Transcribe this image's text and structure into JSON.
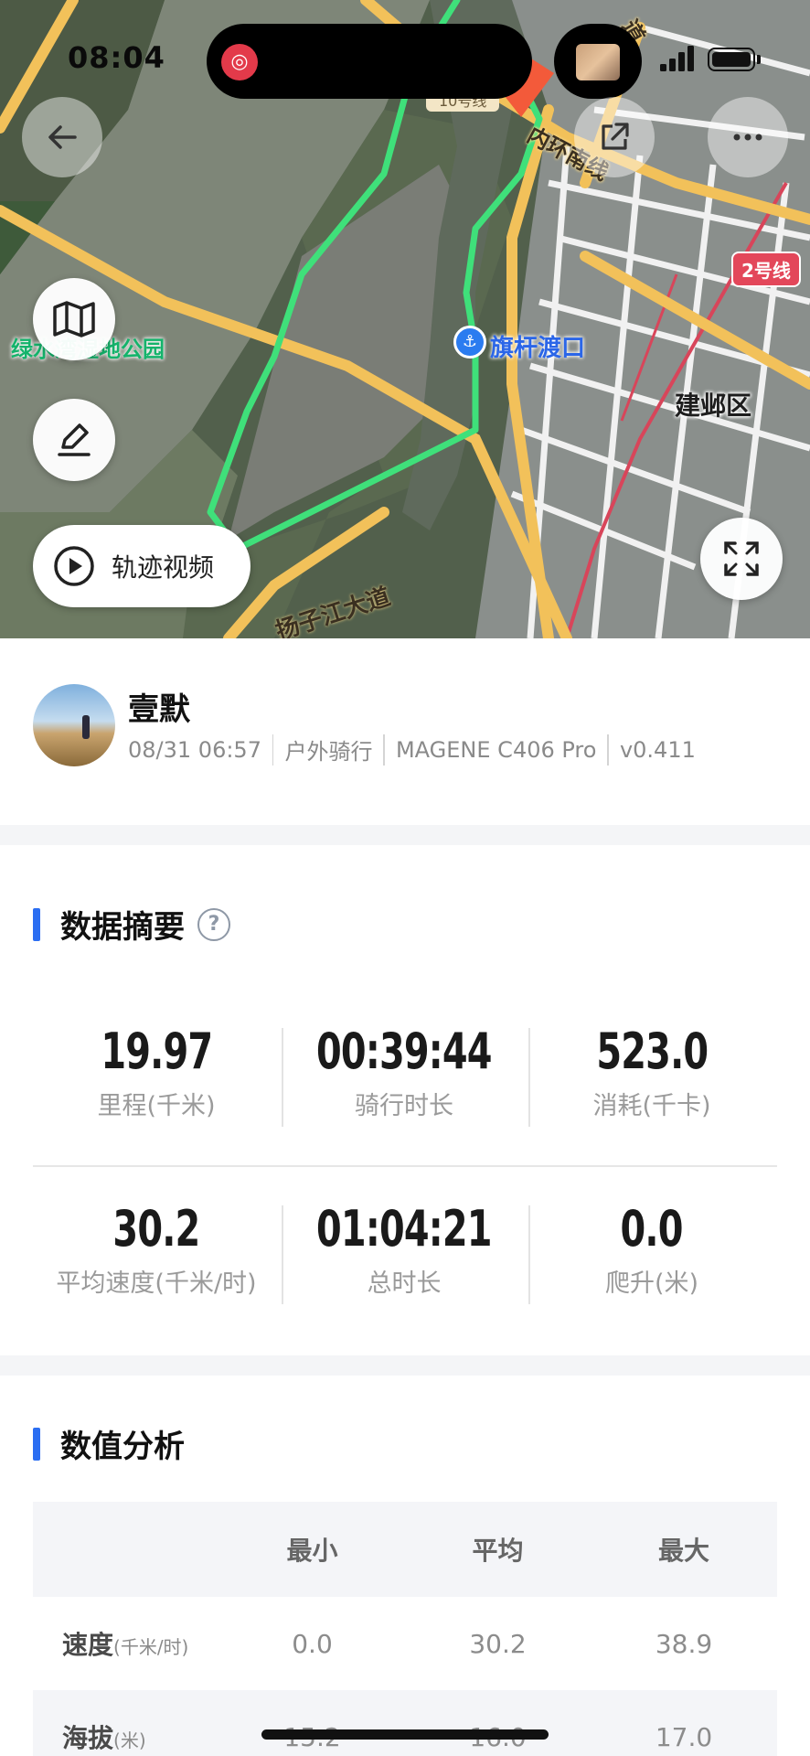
{
  "status_bar": {
    "time": "08:04"
  },
  "map": {
    "labels": {
      "metro_line_10": "10号线",
      "inner_ring_south": "内环南线",
      "metro_line_2": "2号线",
      "green_park": "绿水湾湿地公园",
      "ferry": "旗杆渡口",
      "district": "建邺区",
      "yangzijiang_ave": "扬子江大道",
      "top_road": "道"
    },
    "track_video_label": "轨迹视频",
    "route_color": "#3fe07a"
  },
  "user": {
    "name": "壹默",
    "date": "08/31 06:57",
    "activity": "户外骑行",
    "device": "MAGENE C406 Pro",
    "version": "v0.411"
  },
  "summary": {
    "title": "数据摘要",
    "stats": [
      {
        "value": "19.97",
        "label": "里程(千米)"
      },
      {
        "value": "00:39:44",
        "label": "骑行时长"
      },
      {
        "value": "523.0",
        "label": "消耗(千卡)"
      },
      {
        "value": "30.2",
        "label": "平均速度(千米/时)"
      },
      {
        "value": "01:04:21",
        "label": "总时长"
      },
      {
        "value": "0.0",
        "label": "爬升(米)"
      }
    ]
  },
  "analysis": {
    "title": "数值分析",
    "headers": [
      "最小",
      "平均",
      "最大"
    ],
    "rows": [
      {
        "name": "速度",
        "unit": "(千米/时)",
        "min": "0.0",
        "avg": "30.2",
        "max": "38.9"
      },
      {
        "name": "海拔",
        "unit": "(米)",
        "min": "15.2",
        "avg": "16.0",
        "max": "17.0"
      }
    ]
  },
  "colors": {
    "accent": "#2b6ef2",
    "route": "#3fe07a",
    "road": "#f2c15a"
  }
}
